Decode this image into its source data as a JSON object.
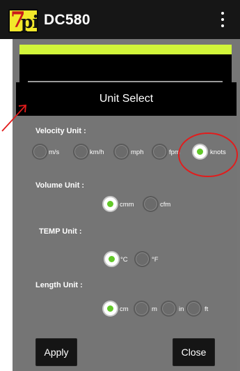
{
  "appbar": {
    "title": "DC580",
    "logo_text": "7pi",
    "menu_icon": "more-vert-icon"
  },
  "dialog": {
    "title": "Unit Select",
    "sections": {
      "velocity": {
        "label": "Velocity Unit :",
        "options": [
          "m/s",
          "km/h",
          "mph",
          "fpm",
          "knots"
        ],
        "selected": "knots"
      },
      "volume": {
        "label": "Volume Unit :",
        "options": [
          "cmm",
          "cfm"
        ],
        "selected": "cmm"
      },
      "temp": {
        "label": "TEMP Unit :",
        "options": [
          "°C",
          "°F"
        ],
        "selected": "°C"
      },
      "length": {
        "label": "Length Unit :",
        "options": [
          "cm",
          "m",
          "in",
          "ft"
        ],
        "selected": "cm"
      }
    },
    "buttons": {
      "apply": "Apply",
      "close": "Close"
    }
  },
  "colors": {
    "appbar": "#161616",
    "accent_bar": "#d2f53a",
    "radio_checked_dot": "#62c829",
    "dialog_bg": "#757575",
    "annotation": "#e21c1c"
  }
}
